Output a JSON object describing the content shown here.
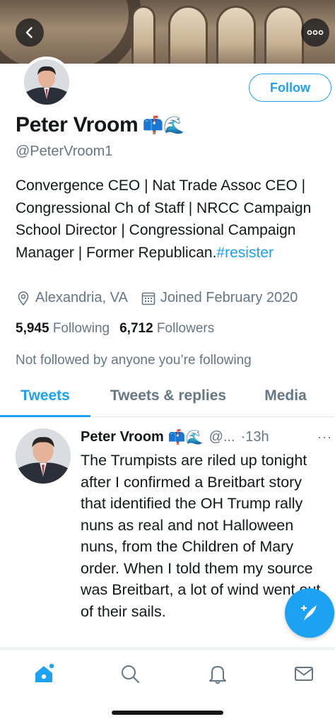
{
  "profile": {
    "name": "Peter Vroom",
    "name_emoji": "📫🌊",
    "handle": "@PeterVroom1",
    "bio_text": "Convergence CEO | Nat Trade Assoc CEO | Congressional Ch of Staff | NRCC Campaign School Director | Congressional Campaign Manager | Former Republican.",
    "bio_hashtag": "#resister",
    "location": "Alexandria, VA",
    "joined": "Joined February 2020",
    "following_count": "5,945",
    "following_label": "Following",
    "followers_count": "6,712",
    "followers_label": "Followers",
    "not_followed_text": "Not followed by anyone you’re following"
  },
  "actions": {
    "follow_label": "Follow"
  },
  "tabs": [
    {
      "label": "Tweets",
      "active": true
    },
    {
      "label": "Tweets & replies",
      "active": false
    },
    {
      "label": "Media",
      "active": false
    }
  ],
  "tweet": {
    "name": "Peter Vroom",
    "name_emoji": "📫🌊",
    "handle": "@...",
    "time": "·13h",
    "more": "···",
    "text": "The Trumpists are riled up tonight after I confirmed a Breitbart story that identified the OH Trump rally nuns as real and not Halloween nuns, from the Children of Mary order. When I told them my source was Breitbart, a lot of wind went out of their sails."
  },
  "icons": {
    "back": "chevron-left-icon",
    "more": "more-icon",
    "location": "location-pin-icon",
    "calendar": "calendar-icon",
    "compose": "compose-tweet-icon",
    "home": "home-icon",
    "search": "search-icon",
    "notifications": "bell-icon",
    "messages": "mail-icon"
  },
  "colors": {
    "accent": "#1da1f2",
    "text": "#14171a",
    "secondary": "#657786",
    "border": "#e1e8ed"
  }
}
